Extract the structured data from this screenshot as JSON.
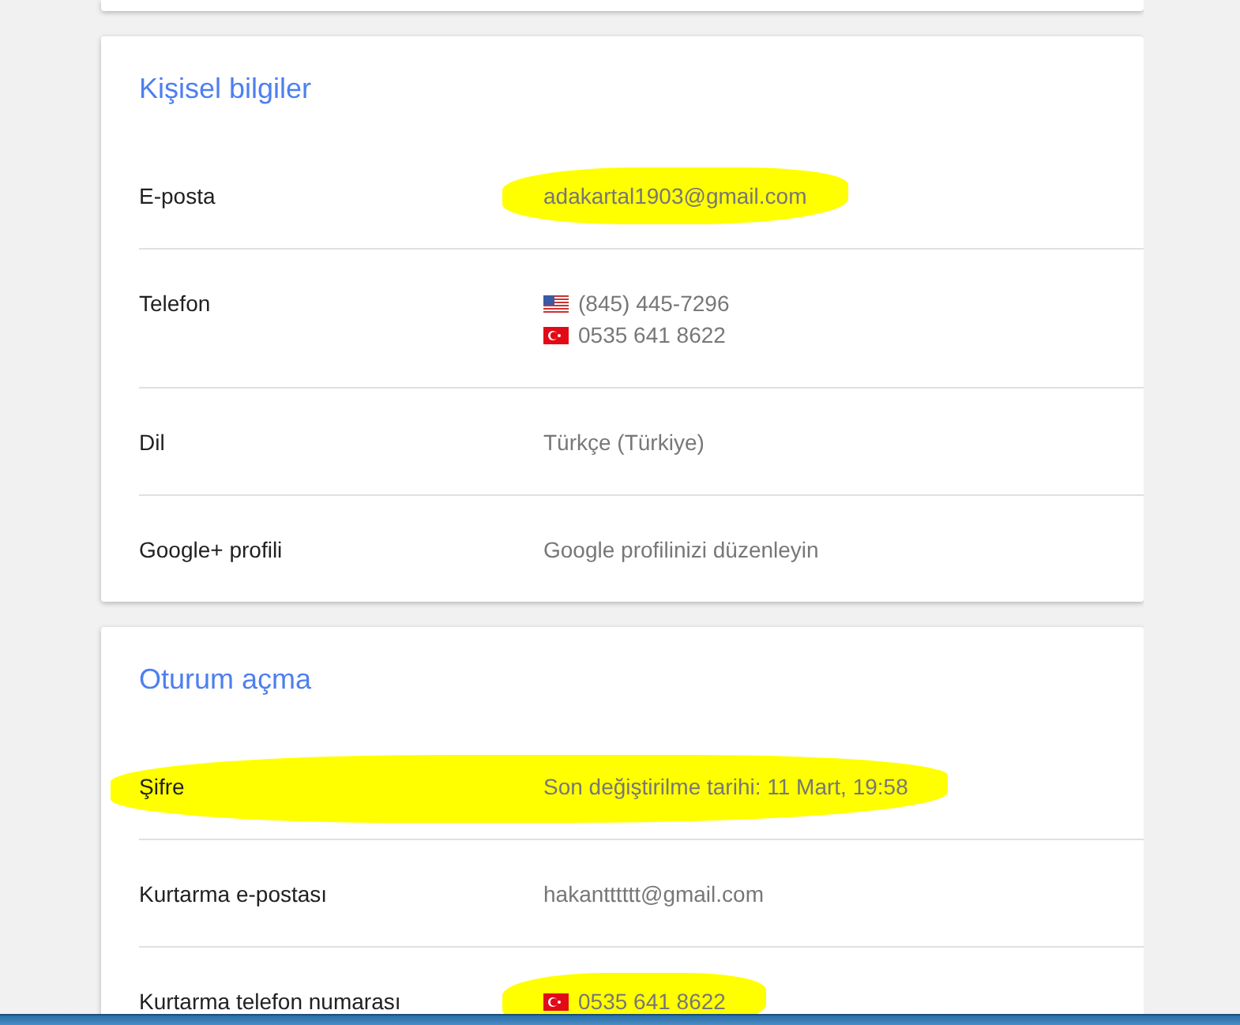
{
  "sections": [
    {
      "title": "Kişisel bilgiler",
      "rows": [
        {
          "label": "E-posta",
          "values": [
            {
              "text": "adakartal1903@gmail.com",
              "kind": "plain",
              "highlighted": true
            }
          ],
          "highlighted": false
        },
        {
          "label": "Telefon",
          "values": [
            {
              "text": "(845) 445-7296",
              "kind": "us",
              "highlighted": false
            },
            {
              "text": "0535 641 8622",
              "kind": "tr",
              "highlighted": false
            }
          ],
          "highlighted": false
        },
        {
          "label": "Dil",
          "values": [
            {
              "text": "Türkçe (Türkiye)",
              "kind": "plain",
              "highlighted": false
            }
          ],
          "highlighted": false
        },
        {
          "label": "Google+ profili",
          "values": [
            {
              "text": "Google profilinizi düzenleyin",
              "kind": "plain",
              "highlighted": false
            }
          ],
          "highlighted": false
        }
      ]
    },
    {
      "title": "Oturum açma",
      "rows": [
        {
          "label": "Şifre",
          "values": [
            {
              "text": "Son değiştirilme tarihi: 11 Mart, 19:58",
              "kind": "plain",
              "highlighted": false
            }
          ],
          "highlighted": true
        },
        {
          "label": "Kurtarma e-postası",
          "values": [
            {
              "text": "hakantttttt@gmail.com",
              "kind": "plain",
              "highlighted": false
            }
          ],
          "highlighted": false
        },
        {
          "label": "Kurtarma telefon numarası",
          "values": [
            {
              "text": "0535 641 8622",
              "kind": "tr",
              "highlighted": true
            }
          ],
          "highlighted": false
        }
      ]
    }
  ]
}
